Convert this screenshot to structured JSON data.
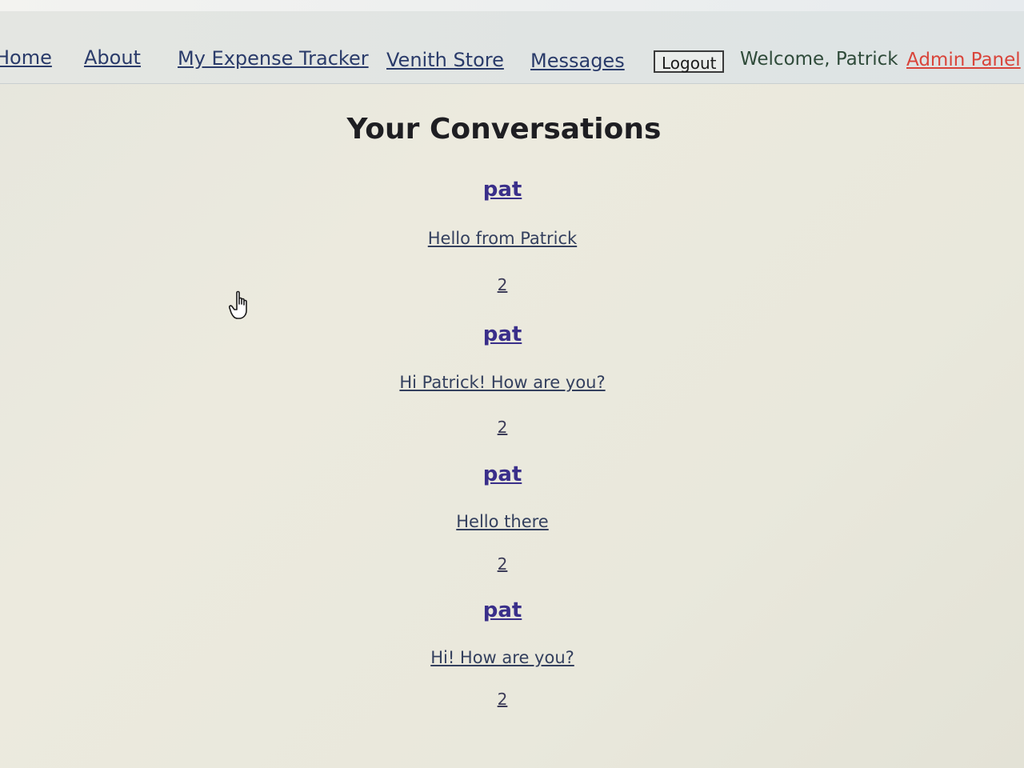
{
  "nav": {
    "home": "Home",
    "about": "About",
    "expense_tracker": "My Expense Tracker",
    "store": "Venith Store",
    "messages": "Messages",
    "logout": "Logout",
    "welcome": "Welcome, Patrick",
    "admin": "Admin Panel"
  },
  "page": {
    "title": "Your Conversations"
  },
  "conversations": [
    {
      "user": "pat",
      "message": "Hello from Patrick",
      "count": "2"
    },
    {
      "user": "pat",
      "message": "Hi Patrick! How are you?",
      "count": "2"
    },
    {
      "user": "pat",
      "message": "Hello there",
      "count": "2"
    },
    {
      "user": "pat",
      "message": "Hi! How are you?",
      "count": "2"
    }
  ],
  "colors": {
    "link": "#2a3b6a",
    "username": "#3a2f8a",
    "admin": "#d9443a",
    "welcome": "#2f4b3a"
  },
  "icons": {
    "cursor": "hand-pointer-icon"
  }
}
